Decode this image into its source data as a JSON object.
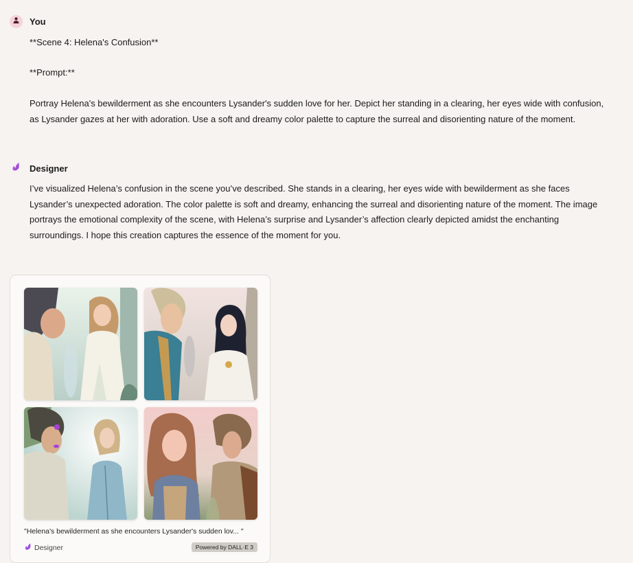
{
  "user_message": {
    "sender": "You",
    "lines": [
      "**Scene 4: Helena's Confusion**",
      "**Prompt:**",
      "Portray Helena's bewilderment as she encounters Lysander's sudden love for her. Depict her standing in a clearing, her eyes wide with confusion, as Lysander gazes at her with adoration. Use a soft and dreamy color palette to capture the surreal and disorienting nature of the moment."
    ]
  },
  "bot_message": {
    "sender": "Designer",
    "text": "I’ve visualized Helena’s confusion in the scene you’ve described. She stands in a clearing, her eyes wide with bewilderment as she faces Lysander’s unexpected adoration. The color palette is soft and dreamy, enhancing the surreal and disorienting nature of the moment. The image portrays the emotional complexity of the scene, with Helena’s surprise and Lysander’s affection clearly depicted amidst the enchanting surroundings. I hope this creation captures the essence of the moment for you."
  },
  "image_card": {
    "caption": "\"Helena's bewilderment as she encounters Lysander's sudden lov... \"",
    "brand_label": "Designer",
    "badge": "Powered by DALL·E 3",
    "images": [
      {
        "alt": "generated-image-1"
      },
      {
        "alt": "generated-image-2"
      },
      {
        "alt": "generated-image-3"
      },
      {
        "alt": "generated-image-4"
      }
    ]
  },
  "colors": {
    "background": "#f6f3f0",
    "user_avatar_bg": "#f6d3d9",
    "designer_accent": "#a855f7"
  }
}
